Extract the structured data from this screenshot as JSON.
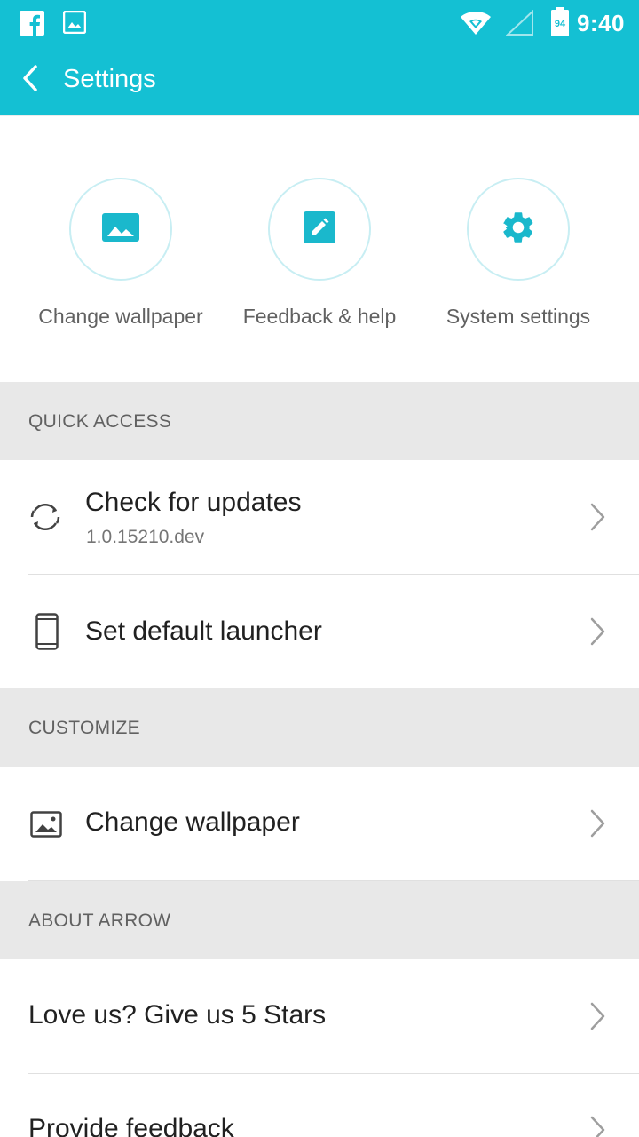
{
  "status_bar": {
    "time": "9:40",
    "battery_level": "94",
    "icons": [
      "facebook-icon",
      "image-icon",
      "wifi-icon",
      "cell-signal-icon",
      "battery-icon"
    ]
  },
  "app_bar": {
    "title": "Settings",
    "back_icon": "chevron-left-icon"
  },
  "shortcuts": [
    {
      "label": "Change wallpaper",
      "icon": "wallpaper-icon"
    },
    {
      "label": "Feedback & help",
      "icon": "edit-icon"
    },
    {
      "label": "System settings",
      "icon": "gear-icon"
    }
  ],
  "sections": {
    "quick_access": {
      "header": "QUICK ACCESS",
      "items": [
        {
          "title": "Check for updates",
          "subtitle": "1.0.15210.dev",
          "icon": "sync-icon"
        },
        {
          "title": "Set default launcher",
          "icon": "phone-icon"
        }
      ]
    },
    "customize": {
      "header": "CUSTOMIZE",
      "items": [
        {
          "title": "Change wallpaper",
          "icon": "image-icon"
        }
      ]
    },
    "about": {
      "header": "ABOUT ARROW",
      "items": [
        {
          "title": "Love us? Give us 5 Stars"
        },
        {
          "title": "Provide feedback"
        }
      ]
    }
  },
  "colors": {
    "primary": "#14c0d3",
    "accent_icon": "#1ab8cc",
    "section_bg": "#e8e8e8",
    "chevron": "#9e9e9e"
  }
}
